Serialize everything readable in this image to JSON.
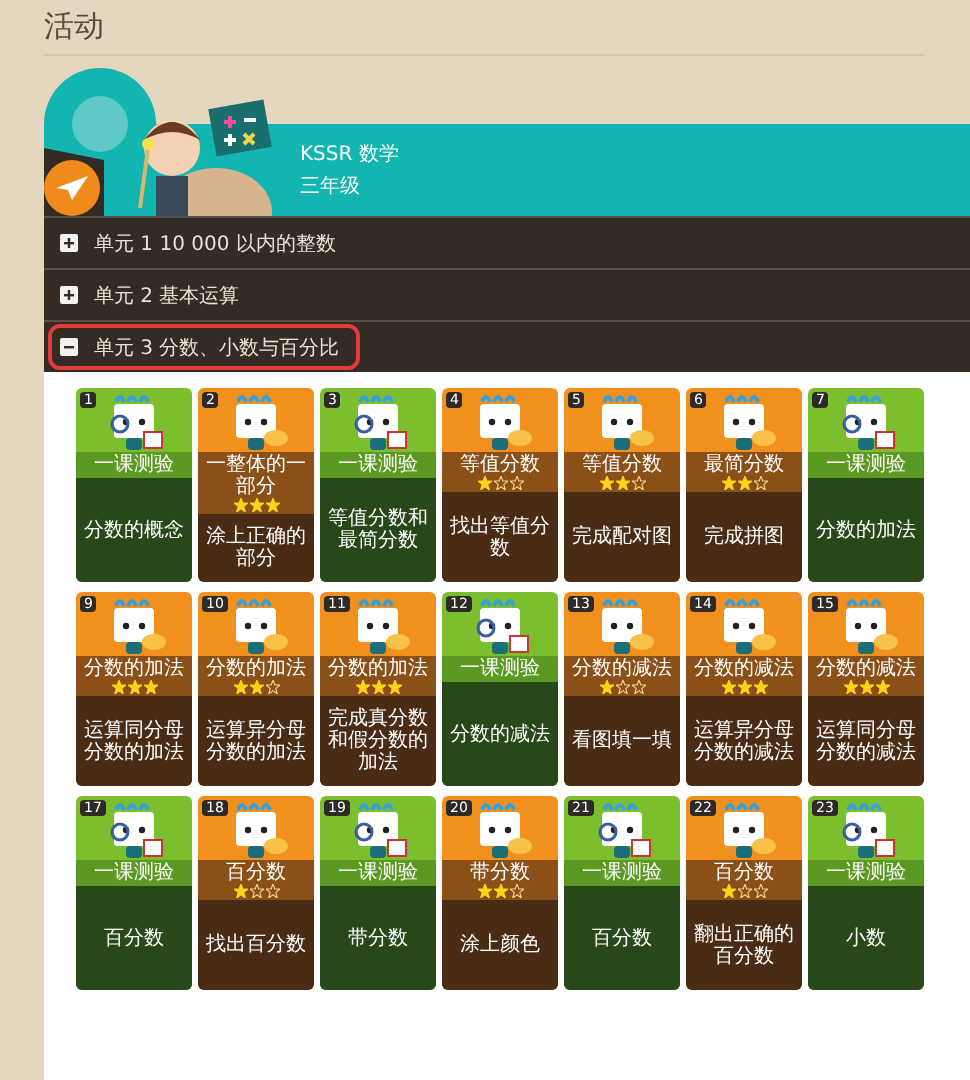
{
  "page": {
    "title": "活动"
  },
  "course": {
    "subject": "KSSR 数学",
    "grade": "三年级"
  },
  "units": [
    {
      "label": "单元 1 10 000 以内的整数",
      "expanded": false,
      "highlighted": false
    },
    {
      "label": "单元 2 基本运算",
      "expanded": false,
      "highlighted": false
    },
    {
      "label": "单元 3 分数、小数与百分比",
      "expanded": true,
      "highlighted": true
    }
  ],
  "activities": [
    {
      "number": "1",
      "kind": "quiz",
      "label": "一课测验",
      "title": "分数的概念"
    },
    {
      "number": "2",
      "kind": "game",
      "label": "一整体的一部分",
      "stars": 3,
      "title": "涂上正确的部分"
    },
    {
      "number": "3",
      "kind": "quiz",
      "label": "一课测验",
      "title": "等值分数和最简分数"
    },
    {
      "number": "4",
      "kind": "game",
      "label": "等值分数",
      "stars": 1,
      "title": "找出等值分数"
    },
    {
      "number": "5",
      "kind": "game",
      "label": "等值分数",
      "stars": 2,
      "title": "完成配对图"
    },
    {
      "number": "6",
      "kind": "game",
      "label": "最简分数",
      "stars": 2,
      "title": "完成拼图"
    },
    {
      "number": "7",
      "kind": "quiz",
      "label": "一课测验",
      "title": "分数的加法"
    },
    {
      "number": "9",
      "kind": "game",
      "label": "分数的加法",
      "stars": 3,
      "title": "运算同分母分数的加法"
    },
    {
      "number": "10",
      "kind": "game",
      "label": "分数的加法",
      "stars": 2,
      "title": "运算异分母分数的加法"
    },
    {
      "number": "11",
      "kind": "game",
      "label": "分数的加法",
      "stars": 3,
      "title": "完成真分数和假分数的加法"
    },
    {
      "number": "12",
      "kind": "quiz",
      "label": "一课测验",
      "title": "分数的减法"
    },
    {
      "number": "13",
      "kind": "game",
      "label": "分数的减法",
      "stars": 1,
      "title": "看图填一填"
    },
    {
      "number": "14",
      "kind": "game",
      "label": "分数的减法",
      "stars": 3,
      "title": "运算异分母分数的减法"
    },
    {
      "number": "15",
      "kind": "game",
      "label": "分数的减法",
      "stars": 3,
      "title": "运算同分母分数的减法"
    },
    {
      "number": "17",
      "kind": "quiz",
      "label": "一课测验",
      "title": "百分数"
    },
    {
      "number": "18",
      "kind": "game",
      "label": "百分数",
      "stars": 1,
      "title": "找出百分数"
    },
    {
      "number": "19",
      "kind": "quiz",
      "label": "一课测验",
      "title": "带分数"
    },
    {
      "number": "20",
      "kind": "game",
      "label": "带分数",
      "stars": 2,
      "title": "涂上颜色"
    },
    {
      "number": "21",
      "kind": "quiz",
      "label": "一课测验",
      "title": "百分数"
    },
    {
      "number": "22",
      "kind": "game",
      "label": "百分数",
      "stars": 1,
      "title": "翻出正确的百分数"
    },
    {
      "number": "23",
      "kind": "quiz",
      "label": "一课测验",
      "title": "小数"
    }
  ]
}
